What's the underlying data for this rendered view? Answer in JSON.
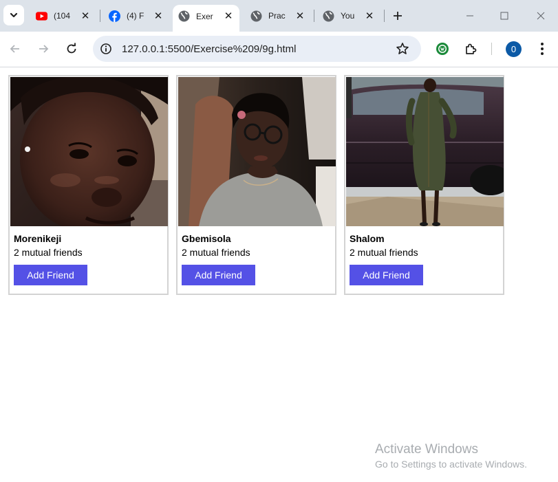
{
  "browser": {
    "tabs": [
      {
        "title": "(104",
        "favicon": "youtube-icon",
        "active": false
      },
      {
        "title": "(4) F",
        "favicon": "facebook-icon",
        "active": false
      },
      {
        "title": "Exer",
        "favicon": "globe-icon",
        "active": true
      },
      {
        "title": "Prac",
        "favicon": "globe-icon",
        "active": false
      },
      {
        "title": "You",
        "favicon": "globe-icon",
        "active": false
      }
    ],
    "url": "127.0.0.1:5500/Exercise%209/9g.html",
    "profile_initial": "0"
  },
  "cards": [
    {
      "name": "Morenikeji",
      "mutual": "2 mutual friends",
      "button": "Add Friend",
      "photo": "selfie-closeup"
    },
    {
      "name": "Gbemisola",
      "mutual": "2 mutual friends",
      "button": "Add Friend",
      "photo": "selfie-glasses"
    },
    {
      "name": "Shalom",
      "mutual": "2 mutual friends",
      "button": "Add Friend",
      "photo": "full-body-by-car"
    }
  ],
  "watermark": {
    "line1": "Activate Windows",
    "line2": "Go to Settings to activate Windows."
  },
  "colors": {
    "button_bg": "#5451e6",
    "tabstrip_bg": "#dde3ea",
    "omnibox_bg": "#e9eef6",
    "youtube_red": "#ff0000",
    "facebook_blue": "#0866ff",
    "avatar_bg": "#0c5aa6"
  }
}
